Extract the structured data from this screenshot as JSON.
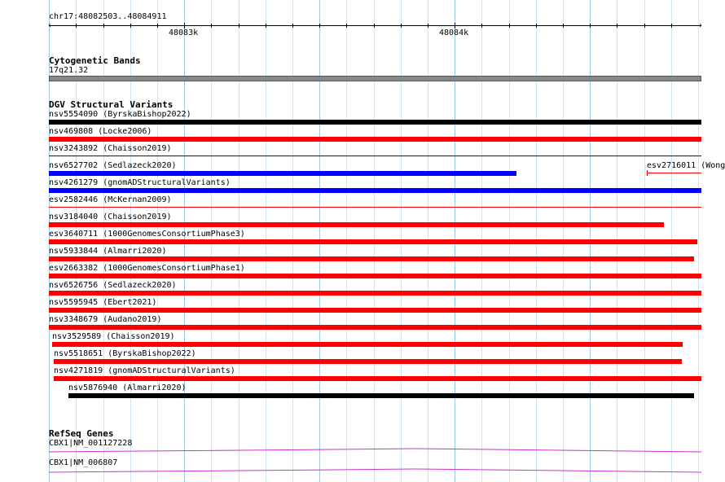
{
  "ruler": {
    "region": "chr17:48082503..48084911",
    "ticks": [
      "48083k",
      "48084k"
    ]
  },
  "cytogenetic": {
    "title": "Cytogenetic Bands",
    "band": "17q21.32",
    "color": "#888888"
  },
  "dgv": {
    "title": "DGV Structural Variants",
    "colors": {
      "loss": "#ff0000",
      "gain": "#0000ff",
      "complex": "#000000"
    },
    "variants": [
      {
        "label": "nsv5554090 (ByrskaBishop2022)",
        "color": "#000000"
      },
      {
        "label": "nsv469808 (Locke2006)",
        "color": "#ff0000"
      },
      {
        "label": "nsv3243892 (Chaisson2019)",
        "color": "#0000ff"
      },
      {
        "label": "nsv6527702 (Sedlazeck2020)",
        "color": "#0000ff"
      },
      {
        "label": "esv2716011 (Wong",
        "color": "#ff0000"
      },
      {
        "label": "nsv4261279 (gnomADStructuralVariants)",
        "color": "#0000ff"
      },
      {
        "label": "esv2582446 (McKernan2009)",
        "color": "#ff0000"
      },
      {
        "label": "nsv3184040 (Chaisson2019)",
        "color": "#ff0000"
      },
      {
        "label": "esv3640711 (1000GenomesConsortiumPhase3)",
        "color": "#ff0000"
      },
      {
        "label": "nsv5933844 (Almarri2020)",
        "color": "#ff0000"
      },
      {
        "label": "esv2663382 (1000GenomesConsortiumPhase1)",
        "color": "#ff0000"
      },
      {
        "label": "nsv6526756 (Sedlazeck2020)",
        "color": "#ff0000"
      },
      {
        "label": "nsv5595945 (Ebert2021)",
        "color": "#ff0000"
      },
      {
        "label": "nsv3348679 (Audano2019)",
        "color": "#ff0000"
      },
      {
        "label": "nsv3529589 (Chaisson2019)",
        "color": "#ff0000"
      },
      {
        "label": "nsv5518651 (ByrskaBishop2022)",
        "color": "#ff0000"
      },
      {
        "label": "nsv4271819 (gnomADStructuralVariants)",
        "color": "#ff0000"
      },
      {
        "label": "nsv5876940 (Almarri2020)",
        "color": "#000000"
      }
    ]
  },
  "refseq": {
    "title": "RefSeq Genes",
    "color": "#cc33cc",
    "genes": [
      {
        "label": "CBX1|NM_001127228"
      },
      {
        "label": "CBX1|NM_006807"
      }
    ]
  }
}
